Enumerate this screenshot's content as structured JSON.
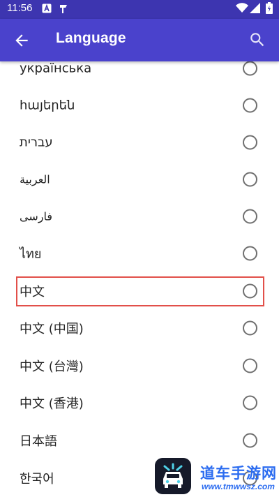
{
  "status_bar": {
    "time": "11:56",
    "icons": [
      "a-notification-icon",
      "pin-notification-icon",
      "wifi-icon",
      "signal-icon",
      "battery-icon"
    ]
  },
  "app_bar": {
    "title": "Language",
    "back_icon": "arrow-left-icon",
    "search_icon": "search-icon",
    "color": "#4a42cc"
  },
  "languages": [
    {
      "label": "українська",
      "selected": false
    },
    {
      "label": "հայերեն",
      "selected": false
    },
    {
      "label": "עברית",
      "selected": false
    },
    {
      "label": "العربية",
      "selected": false
    },
    {
      "label": "فارسی",
      "selected": false
    },
    {
      "label": "ไทย",
      "selected": false
    },
    {
      "label": "中文",
      "selected": false,
      "highlighted": true
    },
    {
      "label": "中文 (中国)",
      "selected": false
    },
    {
      "label": "中文 (台灣)",
      "selected": false
    },
    {
      "label": "中文 (香港)",
      "selected": false
    },
    {
      "label": "日本語",
      "selected": false
    },
    {
      "label": "한국어",
      "selected": false
    }
  ],
  "highlight_color": "#e2504a",
  "watermark": {
    "text": "道车手游网",
    "url": "www.tmwwsz.com"
  }
}
